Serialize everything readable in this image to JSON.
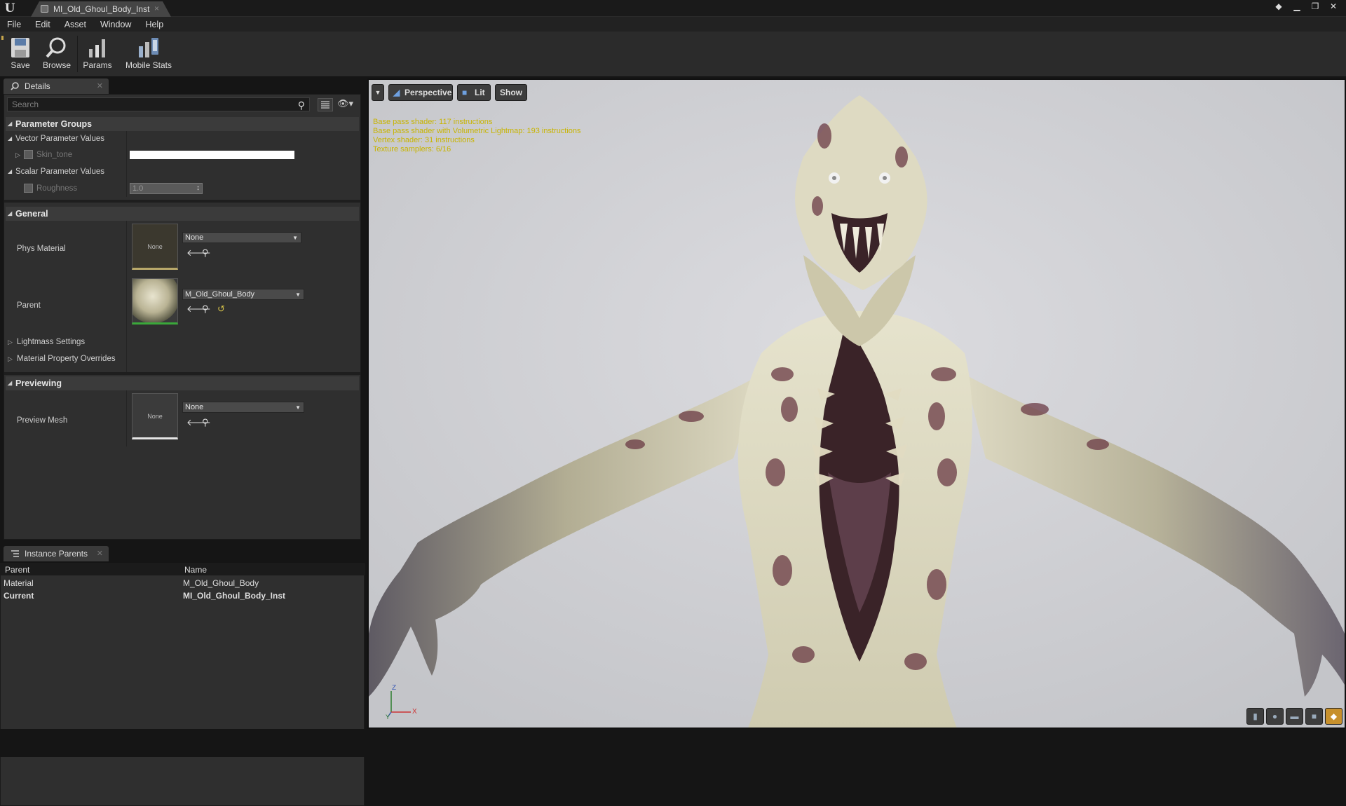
{
  "window": {
    "tab_title": "MI_Old_Ghoul_Body_Inst",
    "close_glyph": "×"
  },
  "menu": [
    "File",
    "Edit",
    "Asset",
    "Window",
    "Help"
  ],
  "toolbar": {
    "save": "Save",
    "browse": "Browse",
    "params": "Params",
    "mobile_stats": "Mobile Stats"
  },
  "details": {
    "tab_label": "Details",
    "search_placeholder": "Search",
    "parameter_groups": "Parameter Groups",
    "vector_param_values": "Vector Parameter Values",
    "skin_tone": "Skin_tone",
    "scalar_param_values": "Scalar Parameter Values",
    "roughness": "Roughness",
    "roughness_value": "1.0",
    "general": "General",
    "phys_material": "Phys Material",
    "phys_material_thumb": "None",
    "phys_material_value": "None",
    "parent": "Parent",
    "parent_value": "M_Old_Ghoul_Body",
    "lightmass_settings": "Lightmass Settings",
    "material_property_overrides": "Material Property Overrides",
    "previewing": "Previewing",
    "preview_mesh": "Preview Mesh",
    "preview_mesh_thumb": "None",
    "preview_mesh_value": "None"
  },
  "instance_parents": {
    "tab_label": "Instance Parents",
    "columns": [
      "Parent",
      "Name"
    ],
    "rows": [
      {
        "parent": "Material",
        "name": "M_Old_Ghoul_Body"
      },
      {
        "parent": "Current",
        "name": "MI_Old_Ghoul_Body_Inst"
      }
    ]
  },
  "viewport": {
    "perspective": "Perspective",
    "lit": "Lit",
    "show": "Show",
    "stats": [
      "Base pass shader: 117 instructions",
      "Base pass shader with Volumetric Lightmap: 193 instructions",
      "Vertex shader: 31 instructions",
      "Texture samplers: 6/16"
    ],
    "axis_z": "Z",
    "axis_x": "X",
    "axis_y": "Y"
  },
  "colors": {
    "accent_gold": "#c7a64c",
    "stats_text": "#c8b400",
    "viewport_bg": "#d3d3d3"
  }
}
